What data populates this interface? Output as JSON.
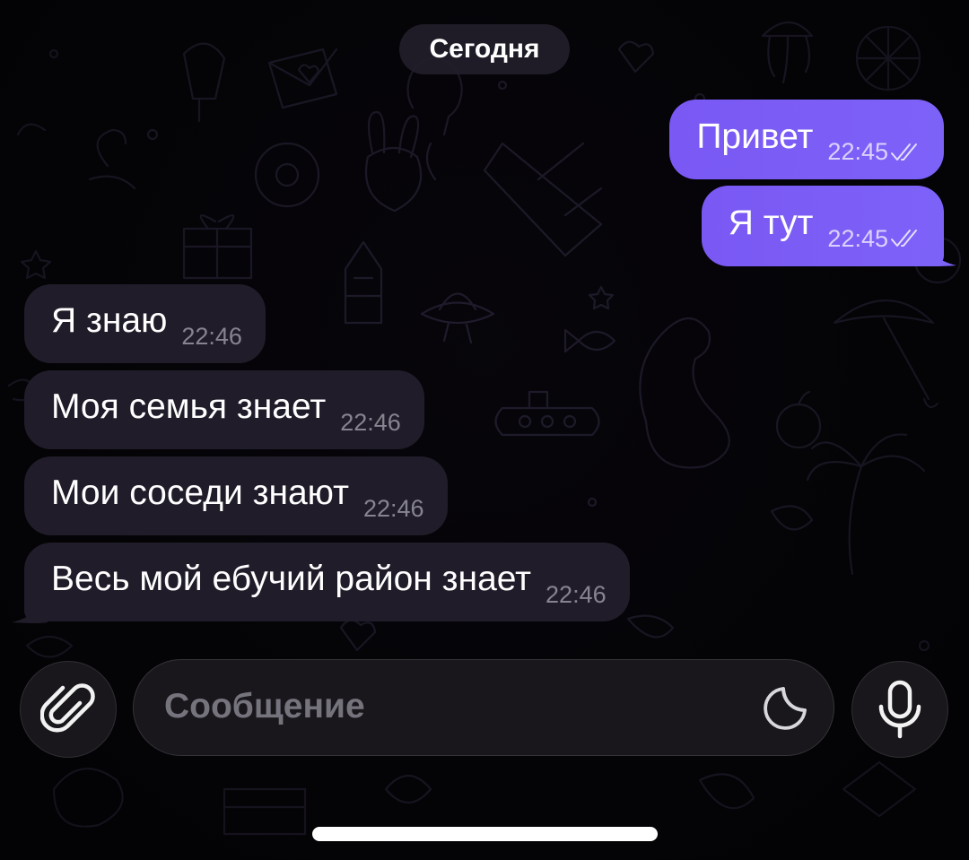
{
  "chat": {
    "date_divider": "Сегодня",
    "messages": [
      {
        "direction": "outgoing",
        "text": "Привет",
        "time": "22:45",
        "status": "read"
      },
      {
        "direction": "outgoing",
        "text": "Я тут",
        "time": "22:45",
        "status": "read"
      },
      {
        "direction": "incoming",
        "text": "Я знаю",
        "time": "22:46"
      },
      {
        "direction": "incoming",
        "text": "Моя семья знает",
        "time": "22:46"
      },
      {
        "direction": "incoming",
        "text": "Мои соседи знают",
        "time": "22:46"
      },
      {
        "direction": "incoming",
        "text": "Весь мой ебучий район знает",
        "time": "22:46"
      }
    ]
  },
  "composer": {
    "placeholder": "Сообщение",
    "value": "",
    "attach_icon": "paperclip-icon",
    "sticker_icon": "sticker-icon",
    "mic_icon": "microphone-icon"
  },
  "colors": {
    "outgoing_bubble": "#7b5cf5",
    "incoming_bubble": "#211d2a",
    "background": "#050407",
    "placeholder": "#75737c"
  }
}
